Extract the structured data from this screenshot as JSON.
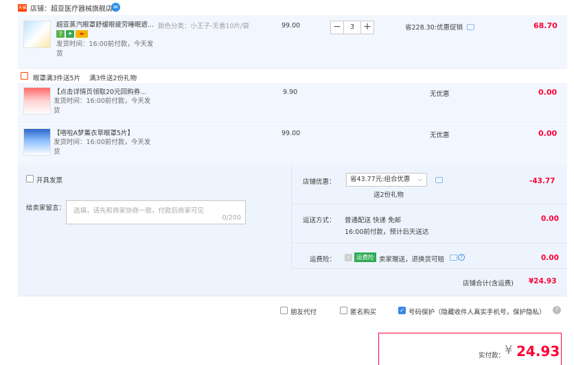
{
  "shop": {
    "badge": "天猫",
    "label": "店铺：",
    "name": "超亚医疗器械旗舰店",
    "ww_icon": "chat-bubble-icon"
  },
  "items": [
    {
      "title": "超亚蒸汽眼罩舒缓眼疲劳睡眠遮...",
      "sku_label": "颜色分类：",
      "sku_value": "小王子-无香10片/袋",
      "ship": "发货时间：16:00前付款，今天发",
      "ship2": "货",
      "price": "99.00",
      "qty": "3",
      "promo": "省228.30:优惠促销",
      "subtotal": "68.70",
      "badges": [
        "7",
        "★",
        "▬"
      ]
    },
    {
      "title": "【点击详情页领取20元回购券...",
      "ship": "发货时间：16:00前付款，今天发",
      "ship2": "货",
      "price": "9.90",
      "promo": "无优惠",
      "subtotal": "0.00"
    },
    {
      "title": "【嗒啦A梦薰衣草眼罩5片】",
      "ship": "发货时间：16:00前付款，今天发",
      "ship2": "货",
      "price": "99.00",
      "promo": "无优惠",
      "subtotal": "0.00"
    }
  ],
  "gift_line": {
    "title": "眼罩满3件送5片",
    "detail": "满3件送2份礼物"
  },
  "invoice": {
    "label": "开具发票"
  },
  "message": {
    "label": "给卖家留言：",
    "placeholder": "选填，请先和商家协商一致，付款后商家可见",
    "counter": "0/200"
  },
  "shop_discount": {
    "label": "店铺优惠：",
    "selected": "省43.77元:组合优惠",
    "note": "送2份礼物",
    "amount": "-43.77"
  },
  "shipping": {
    "label": "运送方式：",
    "method": "普通配送 快递 免邮",
    "time": "16:00前付款，预计后天送达",
    "amount": "0.00"
  },
  "insurance": {
    "label": "运费险：",
    "badge": "运费险",
    "text": "卖家赠送，退换货可赔",
    "amount": "0.00"
  },
  "shop_total": {
    "label": "店铺合计(含运费)",
    "amount": "¥24.93"
  },
  "options": {
    "friend_pay": "朋友代付",
    "anonymous": "匿名购买",
    "number_protect": "号码保护（隐藏收件人真实手机号，保护隐私）"
  },
  "payable": {
    "label": "实付款：",
    "currency": "¥",
    "amount": "24.93"
  },
  "colors": {
    "accent_red": "#ff0036",
    "row_bg": "#f2f7ff",
    "blue": "#3a86e8"
  }
}
